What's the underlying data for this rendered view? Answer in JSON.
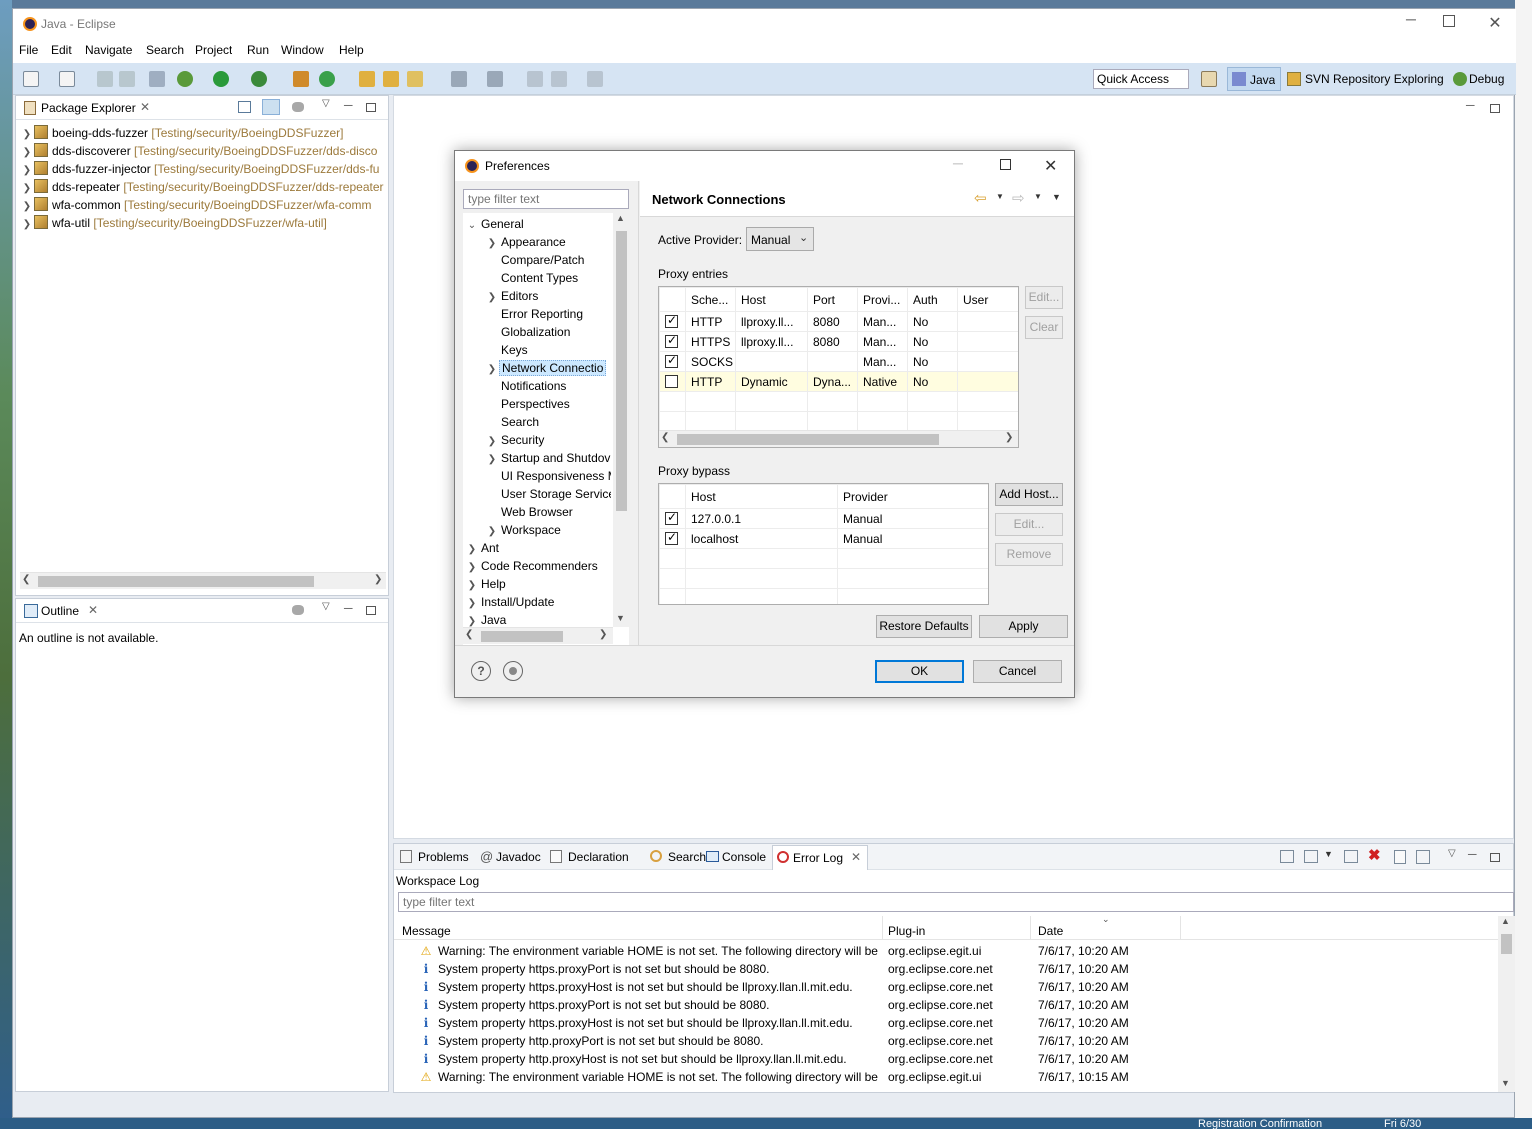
{
  "window": {
    "title": "Java - Eclipse"
  },
  "menu": [
    "File",
    "Edit",
    "Navigate",
    "Search",
    "Project",
    "Run",
    "Window",
    "Help"
  ],
  "toolbar": {
    "quick_access": "Quick Access",
    "perspectives": [
      "Java",
      "SVN Repository Exploring",
      "Debug"
    ]
  },
  "package_explorer": {
    "title": "Package Explorer",
    "projects": [
      {
        "name": "boeing-dds-fuzzer",
        "path": "[Testing/security/BoeingDDSFuzzer]"
      },
      {
        "name": "dds-discoverer",
        "path": "[Testing/security/BoeingDDSFuzzer/dds-disco"
      },
      {
        "name": "dds-fuzzer-injector",
        "path": "[Testing/security/BoeingDDSFuzzer/dds-fu"
      },
      {
        "name": "dds-repeater",
        "path": "[Testing/security/BoeingDDSFuzzer/dds-repeater"
      },
      {
        "name": "wfa-common",
        "path": "[Testing/security/BoeingDDSFuzzer/wfa-comm"
      },
      {
        "name": "wfa-util",
        "path": "[Testing/security/BoeingDDSFuzzer/wfa-util]"
      }
    ]
  },
  "outline": {
    "title": "Outline",
    "message": "An outline is not available."
  },
  "dialog": {
    "title": "Preferences",
    "filter_placeholder": "type filter text",
    "tree": [
      {
        "label": "General",
        "expanded": true,
        "level": 0
      },
      {
        "label": "Appearance",
        "level": 1,
        "expandable": true
      },
      {
        "label": "Compare/Patch",
        "level": 1
      },
      {
        "label": "Content Types",
        "level": 1
      },
      {
        "label": "Editors",
        "level": 1,
        "expandable": true
      },
      {
        "label": "Error Reporting",
        "level": 1
      },
      {
        "label": "Globalization",
        "level": 1
      },
      {
        "label": "Keys",
        "level": 1
      },
      {
        "label": "Network Connectio",
        "level": 1,
        "expandable": true,
        "selected": true
      },
      {
        "label": "Notifications",
        "level": 1
      },
      {
        "label": "Perspectives",
        "level": 1
      },
      {
        "label": "Search",
        "level": 1
      },
      {
        "label": "Security",
        "level": 1,
        "expandable": true
      },
      {
        "label": "Startup and Shutdov",
        "level": 1,
        "expandable": true
      },
      {
        "label": "UI Responsiveness M",
        "level": 1
      },
      {
        "label": "User Storage Service",
        "level": 1
      },
      {
        "label": "Web Browser",
        "level": 1
      },
      {
        "label": "Workspace",
        "level": 1,
        "expandable": true
      },
      {
        "label": "Ant",
        "level": 0,
        "expandable": true
      },
      {
        "label": "Code Recommenders",
        "level": 0,
        "expandable": true
      },
      {
        "label": "Help",
        "level": 0,
        "expandable": true
      },
      {
        "label": "Install/Update",
        "level": 0,
        "expandable": true
      },
      {
        "label": "Java",
        "level": 0,
        "expandable": true
      }
    ],
    "page_title": "Network Connections",
    "active_provider_label": "Active Provider:",
    "active_provider_value": "Manual",
    "proxy_entries_label": "Proxy entries",
    "proxy_cols": [
      "Sche...",
      "Host",
      "Port",
      "Provi...",
      "Auth",
      "User"
    ],
    "proxy_rows": [
      {
        "checked": true,
        "scheme": "HTTP",
        "host": "llproxy.ll...",
        "port": "8080",
        "provider": "Man...",
        "auth": "No",
        "user": ""
      },
      {
        "checked": true,
        "scheme": "HTTPS",
        "host": "llproxy.ll...",
        "port": "8080",
        "provider": "Man...",
        "auth": "No",
        "user": ""
      },
      {
        "checked": true,
        "scheme": "SOCKS",
        "host": "",
        "port": "",
        "provider": "Man...",
        "auth": "No",
        "user": ""
      },
      {
        "checked": false,
        "scheme": "HTTP",
        "host": "Dynamic",
        "port": "Dyna...",
        "provider": "Native",
        "auth": "No",
        "user": ""
      }
    ],
    "edit_btn": "Edit...",
    "clear_btn": "Clear",
    "proxy_bypass_label": "Proxy bypass",
    "bypass_cols": [
      "Host",
      "Provider"
    ],
    "bypass_rows": [
      {
        "checked": true,
        "host": "127.0.0.1",
        "provider": "Manual"
      },
      {
        "checked": true,
        "host": "localhost",
        "provider": "Manual"
      }
    ],
    "add_host_btn": "Add Host...",
    "edit2_btn": "Edit...",
    "remove_btn": "Remove",
    "restore_btn": "Restore Defaults",
    "apply_btn": "Apply",
    "ok_btn": "OK",
    "cancel_btn": "Cancel"
  },
  "bottom_tabs": [
    "Problems",
    "Javadoc",
    "Declaration",
    "Search",
    "Console",
    "Error Log"
  ],
  "error_log": {
    "title": "Workspace Log",
    "filter_placeholder": "type filter text",
    "cols": [
      "Message",
      "Plug-in",
      "Date"
    ],
    "rows": [
      {
        "type": "warning",
        "message": "Warning: The environment variable HOME is not set. The following directory will be",
        "plugin": "org.eclipse.egit.ui",
        "date": "7/6/17, 10:20 AM"
      },
      {
        "type": "info",
        "message": "System property https.proxyPort is not set but should be 8080.",
        "plugin": "org.eclipse.core.net",
        "date": "7/6/17, 10:20 AM"
      },
      {
        "type": "info",
        "message": "System property https.proxyHost is not set but should be llproxy.llan.ll.mit.edu.",
        "plugin": "org.eclipse.core.net",
        "date": "7/6/17, 10:20 AM"
      },
      {
        "type": "info",
        "message": "System property https.proxyPort is not set but should be 8080.",
        "plugin": "org.eclipse.core.net",
        "date": "7/6/17, 10:20 AM"
      },
      {
        "type": "info",
        "message": "System property https.proxyHost is not set but should be llproxy.llan.ll.mit.edu.",
        "plugin": "org.eclipse.core.net",
        "date": "7/6/17, 10:20 AM"
      },
      {
        "type": "info",
        "message": "System property http.proxyPort is not set but should be 8080.",
        "plugin": "org.eclipse.core.net",
        "date": "7/6/17, 10:20 AM"
      },
      {
        "type": "info",
        "message": "System property http.proxyHost is not set but should be llproxy.llan.ll.mit.edu.",
        "plugin": "org.eclipse.core.net",
        "date": "7/6/17, 10:20 AM"
      },
      {
        "type": "warning",
        "message": "Warning: The environment variable HOME is not set. The following directory will be",
        "plugin": "org.eclipse.egit.ui",
        "date": "7/6/17, 10:15 AM"
      }
    ]
  },
  "taskbar": {
    "item": "Registration Confirmation",
    "date": "Fri 6/30"
  },
  "colors": {
    "accent": "#0078d7",
    "selection": "#cce8ff",
    "toolbar": "#d6e4f3",
    "path": "#9c7a3c"
  }
}
